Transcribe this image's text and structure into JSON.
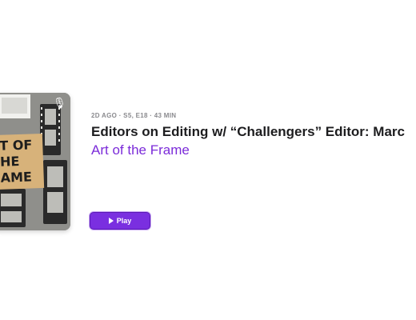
{
  "episode": {
    "meta": "2D AGO · S5, E18 · 43 MIN",
    "title": "Editors on Editing w/ “Challengers” Editor: Marc",
    "show_name": "Art of the Frame",
    "play_label": "Play"
  },
  "artwork": {
    "lines": [
      "T OF",
      "HE",
      "AME"
    ],
    "icon": "podcast-icon"
  },
  "colors": {
    "accent": "#7a2fe0",
    "link": "#7b2bd9",
    "meta": "#8a8a8e",
    "title": "#1d1d1f"
  }
}
